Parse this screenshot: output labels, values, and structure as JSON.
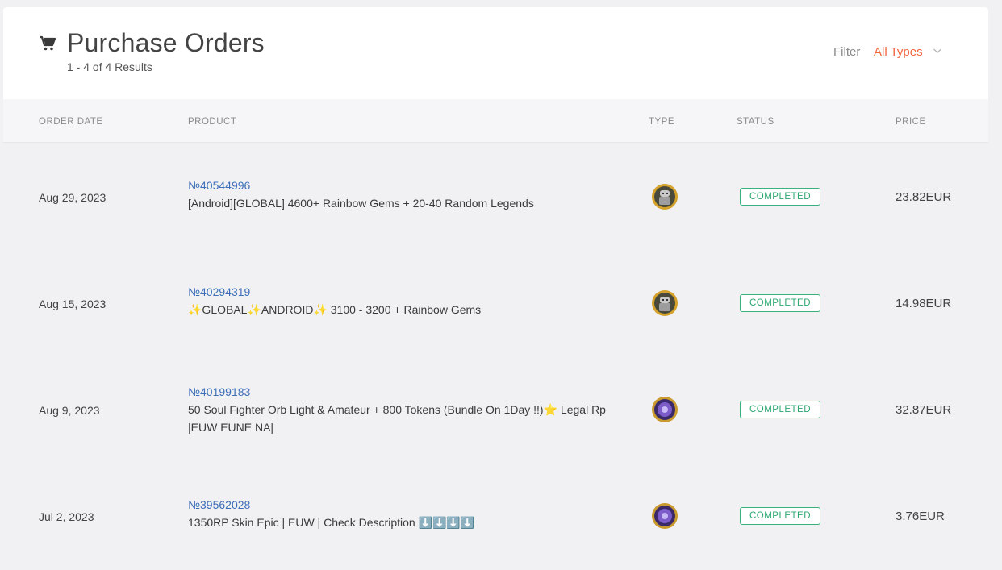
{
  "header": {
    "title": "Purchase Orders",
    "results": "1 - 4 of 4 Results",
    "filter_label": "Filter",
    "filter_value": "All Types"
  },
  "columns": {
    "order_date": "ORDER DATE",
    "product": "PRODUCT",
    "type": "TYPE",
    "status": "STATUS",
    "price": "PRICE"
  },
  "orders": [
    {
      "date": "Aug 29, 2023",
      "order_no": "№40544996",
      "product": "[Android][GLOBAL] 4600+ Rainbow Gems + 20-40 Random Legends",
      "type_icon": "robot-game-icon",
      "status": "COMPLETED",
      "price": "23.82EUR"
    },
    {
      "date": "Aug 15, 2023",
      "order_no": "№40294319",
      "product": "✨GLOBAL✨ANDROID✨ 3100 - 3200 + Rainbow Gems",
      "type_icon": "robot-game-icon",
      "status": "COMPLETED",
      "price": "14.98EUR"
    },
    {
      "date": "Aug 9, 2023",
      "order_no": "№40199183",
      "product": "50 Soul Fighter Orb Light & Amateur + 800 Tokens (Bundle On 1Day !!)⭐ Legal Rp |EUW EUNE NA|",
      "type_icon": "league-game-icon",
      "status": "COMPLETED",
      "price": "32.87EUR"
    },
    {
      "date": "Jul 2, 2023",
      "order_no": "№39562028",
      "product": "1350RP Skin Epic | EUW | Check Description ⬇️⬇️⬇️⬇️",
      "type_icon": "league-game-icon",
      "status": "COMPLETED",
      "price": "3.76EUR"
    }
  ],
  "colors": {
    "accent": "#f2643c",
    "link": "#3e6fb8",
    "status_green": "#2ea76f"
  }
}
